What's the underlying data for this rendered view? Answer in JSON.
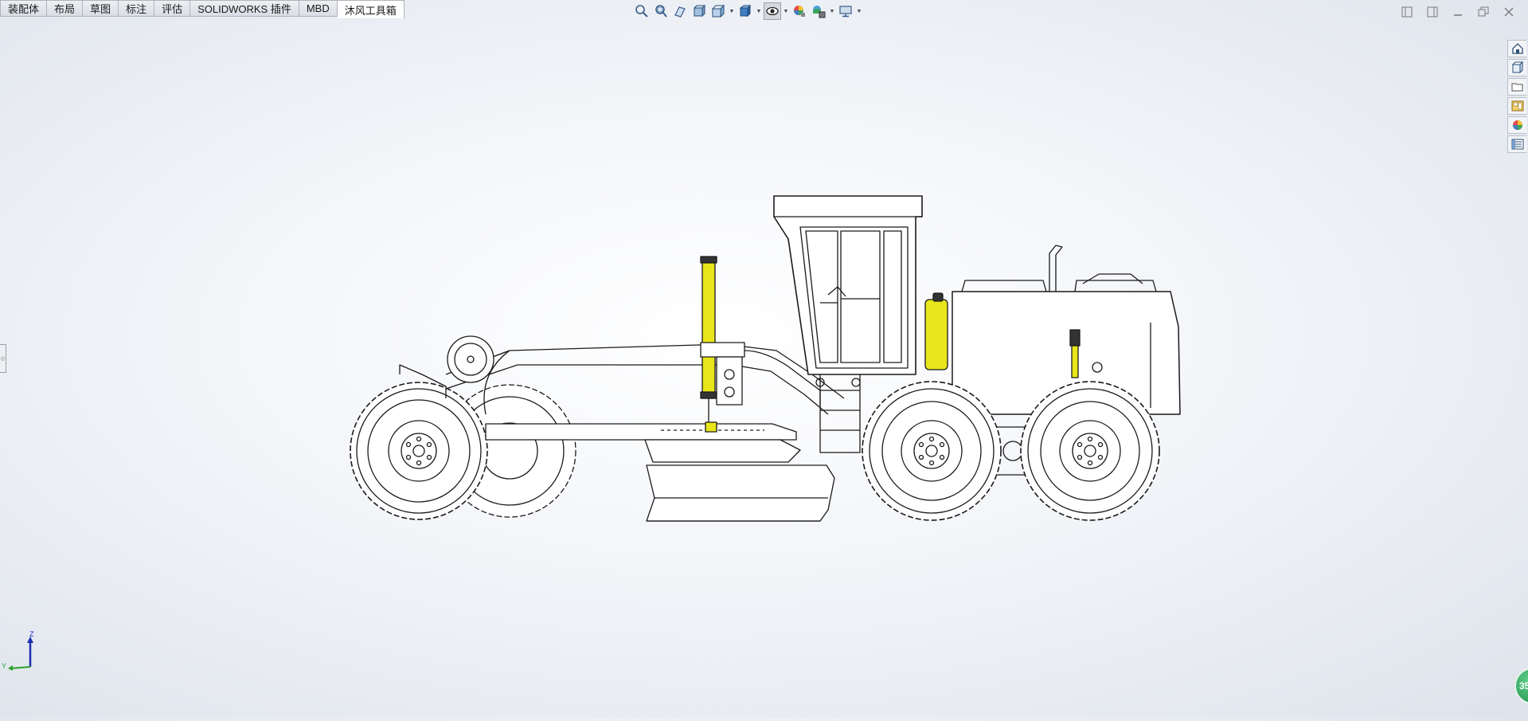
{
  "tabs": [
    {
      "label": "装配体"
    },
    {
      "label": "布局"
    },
    {
      "label": "草图"
    },
    {
      "label": "标注"
    },
    {
      "label": "评估"
    },
    {
      "label": "SOLIDWORKS 插件"
    },
    {
      "label": "MBD"
    },
    {
      "label": "沐风工具箱"
    }
  ],
  "active_tab": "沐风工具箱",
  "triad": {
    "z_label": "Z",
    "y_label": "Y"
  },
  "badge": {
    "label": "35"
  },
  "colors": {
    "accent_yellow": "#e8e61a",
    "line": "#1a1a1a",
    "background": "#eef1f6"
  }
}
